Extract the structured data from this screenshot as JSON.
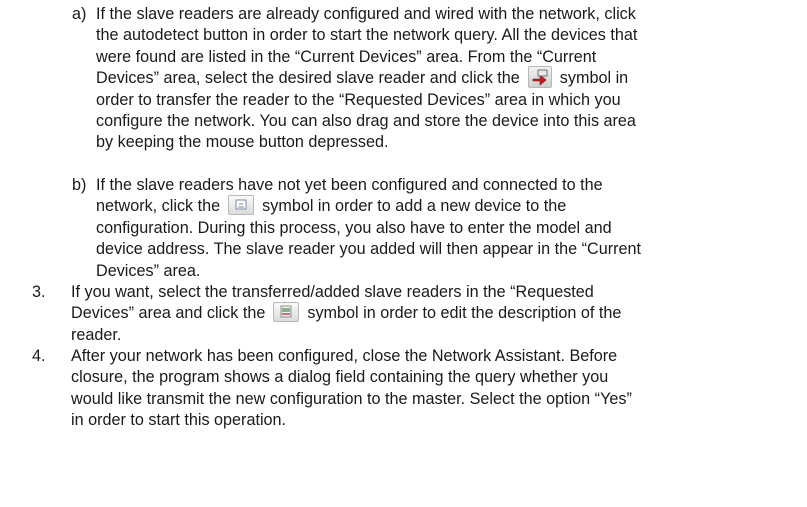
{
  "items": [
    {
      "marker": "a)",
      "segments": [
        "If the slave readers are already configured and wired with the network, click",
        "the autodetect button in order to start the network query. All the devices that",
        "were found are listed in the “Current Devices” area. From the “Current",
        "Devices” area, select the desired slave reader and click the",
        "symbol in",
        "order to transfer the reader to the “Requested Devices” area in which you",
        "configure the network. You can also drag and store the device into this area",
        "by keeping the mouse button depressed."
      ]
    },
    {
      "marker": "b)",
      "segments": [
        "If the slave readers have not yet been configured and connected to the",
        "network, click the",
        "symbol in order to add a new device to the",
        "configuration. During this process, you also have to enter the model and",
        "device address. The slave reader you added will then appear in the “Current",
        "Devices” area."
      ]
    },
    {
      "marker": "3.",
      "segments": [
        "If you want, select the transferred/added slave readers in the “Requested",
        "Devices” area and click the",
        "symbol in order to edit the description of the",
        "reader."
      ]
    },
    {
      "marker": "4.",
      "segments": [
        "After your network has been configured, close the Network Assistant. Before",
        "closure, the program shows a dialog field containing the query whether you",
        "would like transmit the new configuration to the master. Select the option “Yes”",
        "in order to start this operation."
      ]
    }
  ],
  "icons": {
    "transfer": "transfer-device-icon",
    "add": "add-device-icon",
    "edit": "edit-description-icon"
  }
}
